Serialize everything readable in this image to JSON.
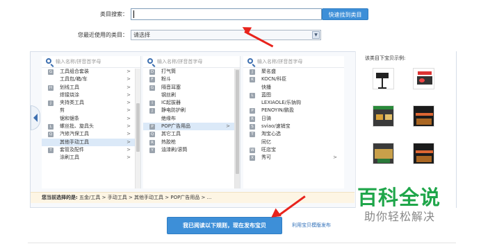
{
  "form": {
    "category_search_label": "类目搜索：",
    "search_value": "",
    "quick_find_button": "快速找到类目",
    "recent_label": "您最近使用的类目：",
    "recent_select": "请选择"
  },
  "columns": [
    {
      "placeholder": "输入名称/拼音首字母",
      "items": [
        {
          "letter": "G",
          "label": "工具组合套装",
          "arrow": ">"
        },
        {
          "letter": "",
          "label": "工具包/箱/车",
          "arrow": ">"
        },
        {
          "letter": "H",
          "label": "划线工具",
          "arrow": ">"
        },
        {
          "letter": "",
          "label": "焊接烧涂",
          "arrow": ">"
        },
        {
          "letter": "J",
          "label": "夹持类工具",
          "arrow": ">"
        },
        {
          "letter": "",
          "label": "剪",
          "arrow": ">"
        },
        {
          "letter": "",
          "label": "锯和锯条",
          "arrow": ">"
        },
        {
          "letter": "L",
          "label": "螺丝批、旋具头",
          "arrow": ">"
        },
        {
          "letter": "Q",
          "label": "汽修汽保工具",
          "arrow": ">"
        },
        {
          "letter": "",
          "label": "其他手动工具",
          "arrow": ">"
        },
        {
          "letter": "T",
          "label": "套管及配件",
          "arrow": ">"
        },
        {
          "letter": "",
          "label": "涂刷工具",
          "arrow": ">"
        }
      ]
    },
    {
      "placeholder": "输入名称/拼音首字母",
      "items": [
        {
          "letter": "D",
          "label": "打气筒",
          "arrow": ""
        },
        {
          "letter": "F",
          "label": "粉斗",
          "arrow": ""
        },
        {
          "letter": "G",
          "label": "隔音耳塞",
          "arrow": ""
        },
        {
          "letter": "",
          "label": "钢丝刷",
          "arrow": ""
        },
        {
          "letter": "I",
          "label": "IC起拔器",
          "arrow": ""
        },
        {
          "letter": "J",
          "label": "静电防护刷",
          "arrow": ""
        },
        {
          "letter": "",
          "label": "绝缘布",
          "arrow": ""
        },
        {
          "letter": "P",
          "label": "POP广告用品",
          "arrow": ">"
        },
        {
          "letter": "Q",
          "label": "其它工具",
          "arrow": ""
        },
        {
          "letter": "R",
          "label": "热胶枪",
          "arrow": ""
        },
        {
          "letter": "Y",
          "label": "油漆刷/滚筒",
          "arrow": ""
        }
      ]
    },
    {
      "placeholder": "输入名称/拼音首字母",
      "items": [
        {
          "letter": "J",
          "label": "聚名盛",
          "arrow": ""
        },
        {
          "letter": "K",
          "label": "KOCN/科臣",
          "arrow": ""
        },
        {
          "letter": "",
          "label": "快播",
          "arrow": ""
        },
        {
          "letter": "L",
          "label": "蓝图",
          "arrow": ""
        },
        {
          "letter": "",
          "label": "LEXIAOLE/乐钠钩",
          "arrow": ""
        },
        {
          "letter": "P",
          "label": "PENOYIN/鹏盈",
          "arrow": ""
        },
        {
          "letter": "R",
          "label": "日骑",
          "arrow": ""
        },
        {
          "letter": "S",
          "label": "sviao/速销宝",
          "arrow": ""
        },
        {
          "letter": "T",
          "label": "淘宝心选",
          "arrow": ""
        },
        {
          "letter": "",
          "label": "同亿",
          "arrow": ""
        },
        {
          "letter": "W",
          "label": "旺店宝",
          "arrow": ""
        },
        {
          "letter": "X",
          "label": "秀可",
          "arrow": ">"
        }
      ]
    }
  ],
  "preview": {
    "title": "该类目下宝贝示例:"
  },
  "breadcrumb": {
    "prefix": "您当前选择的是:",
    "path": "五金/工具 > 手动工具 > 其他手动工具 > POP广告用品 > ..."
  },
  "actions": {
    "publish_button": "我已阅读以下规则，现在发布宝贝",
    "template_link": "利用宝贝模版发布"
  },
  "watermark": {
    "title": "百科全说",
    "subtitle": "助你轻松解决"
  },
  "colors": {
    "accent": "#3d8fd8",
    "arrow": "#e8231c",
    "watermark": "#1fa64a"
  }
}
